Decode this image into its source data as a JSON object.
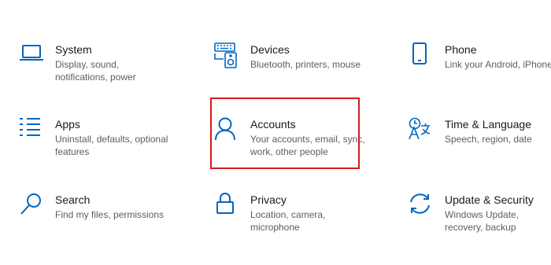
{
  "tiles": [
    {
      "title": "System",
      "description": "Display, sound, notifications, power",
      "icon": "laptop-icon"
    },
    {
      "title": "Devices",
      "description": "Bluetooth, printers, mouse",
      "icon": "keyboard-speaker-icon"
    },
    {
      "title": "Phone",
      "description": "Link your Android, iPhone",
      "icon": "phone-icon"
    },
    {
      "title": "Apps",
      "description": "Uninstall, defaults, optional features",
      "icon": "list-icon"
    },
    {
      "title": "Accounts",
      "description": "Your accounts, email, sync, work, other people",
      "icon": "person-icon"
    },
    {
      "title": "Time & Language",
      "description": "Speech, region, date",
      "icon": "language-icon"
    },
    {
      "title": "Search",
      "description": "Find my files, permissions",
      "icon": "search-icon"
    },
    {
      "title": "Privacy",
      "description": "Location, camera, microphone",
      "icon": "lock-icon"
    },
    {
      "title": "Update & Security",
      "description": "Windows Update, recovery, backup",
      "icon": "sync-icon"
    }
  ],
  "colors": {
    "accent": "#0067c0",
    "title": "#1a1a1a",
    "description": "#5d5d5d",
    "highlight": "#d9191e"
  },
  "highlighted_tile": "Accounts"
}
